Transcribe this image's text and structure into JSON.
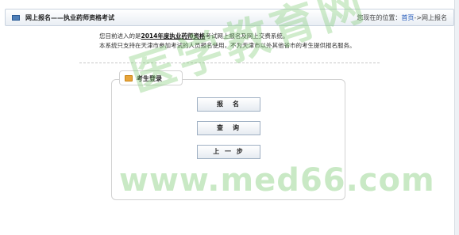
{
  "header": {
    "title": "网上报名——执业药师资格考试",
    "location_prefix": "您现在的位置：",
    "crumb_home": "首页",
    "crumb_sep": "->",
    "crumb_current": "网上报名"
  },
  "intro": {
    "line1_pre": "您目前进入的是",
    "line1_emph": "2014年度执业药师资格",
    "line1_post": "考试网上报名及网上交费系统。",
    "line2": "本系统只支持在天津市参加考试的人员报名使用，不为天津市以外其他省市的考生提供报名服务。"
  },
  "login": {
    "tab_label": "考生登录",
    "buttons": [
      "报　名",
      "查　询",
      "上 一 步"
    ]
  },
  "watermark": {
    "cn": "医学教育网",
    "url": "www.med66.com"
  },
  "icons": {
    "header": "list-icon",
    "tab": "folder-icon"
  }
}
